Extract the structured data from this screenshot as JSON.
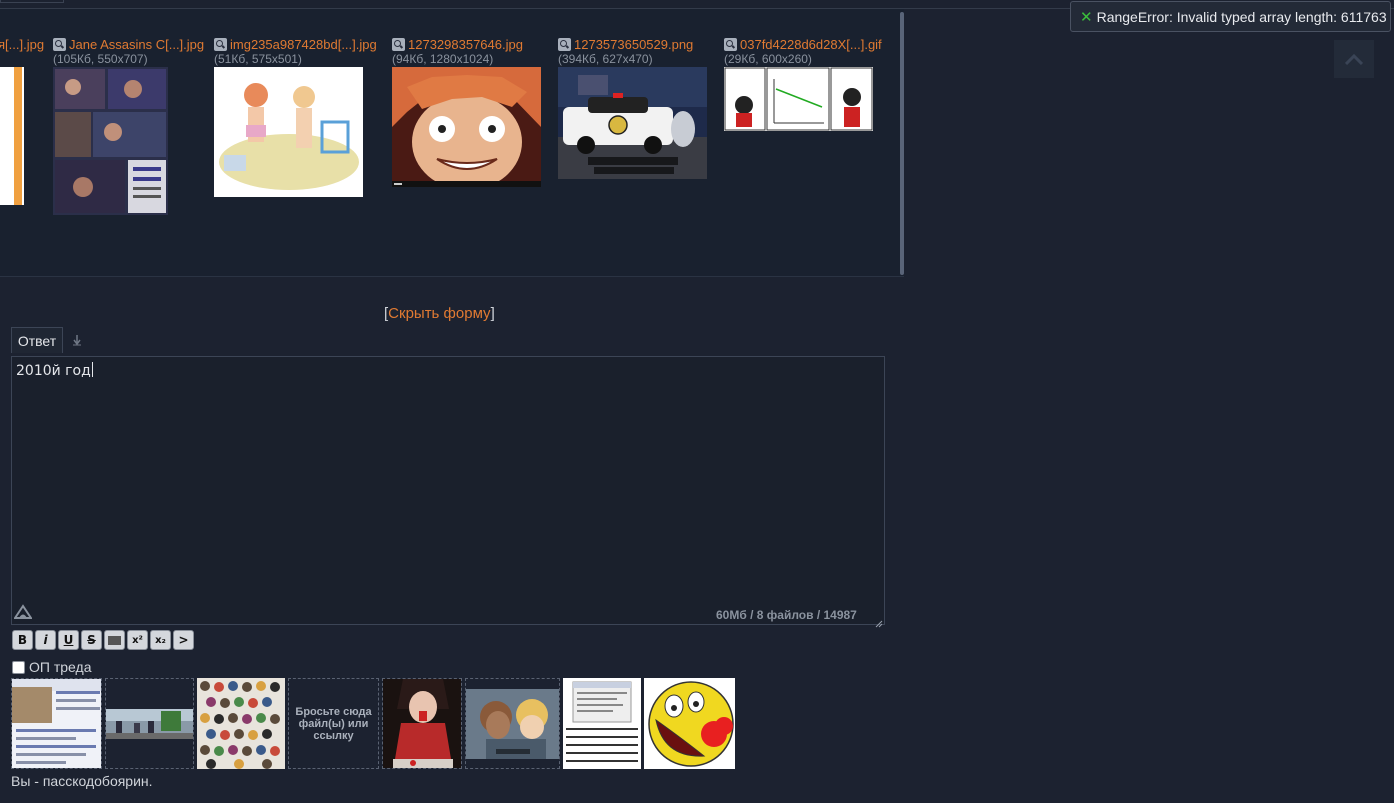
{
  "error_toast": {
    "icon": "close-icon",
    "message": "RangeError: Invalid typed array length: 611763"
  },
  "files": [
    {
      "name": "я[...].jpg",
      "meta": ""
    },
    {
      "name": "Jane Assasins C[...].jpg",
      "meta": "(105Кб, 550x707)"
    },
    {
      "name": "img235a987428bd[...].jpg",
      "meta": "(51Кб, 575x501)"
    },
    {
      "name": "1273298357646.jpg",
      "meta": "(94Кб, 1280x1024)"
    },
    {
      "name": "1273573650529.png",
      "meta": "(394Кб, 627x470)"
    },
    {
      "name": "037fd4228d6d28X[...].gif",
      "meta": "(29Кб, 600x260)"
    }
  ],
  "hide_form": {
    "open": "[",
    "link": "Скрыть форму",
    "close": "]"
  },
  "reply": {
    "tab_label": "Ответ",
    "text": "2010й год",
    "counter": "60Мб / 8 файлов / 14987"
  },
  "format_buttons": [
    "B",
    "i",
    "U",
    "S",
    "",
    "x²",
    "x₂",
    ">"
  ],
  "op_checkbox_label": "ОП треда",
  "drop_zone_text": "Бросьте сюда файл(ы) или ссылку",
  "identity_text": "Вы - пасскодобоярин."
}
